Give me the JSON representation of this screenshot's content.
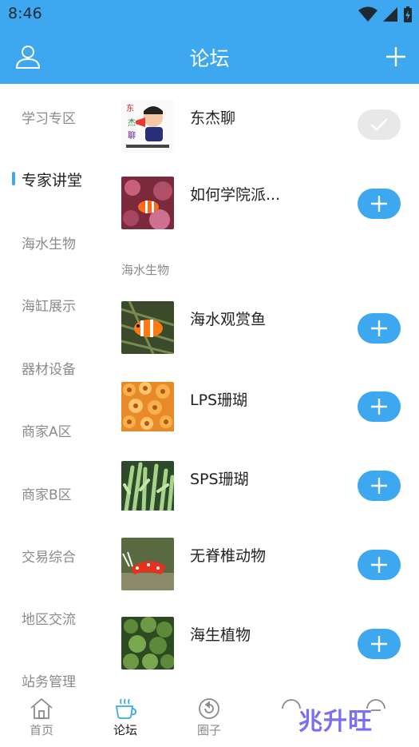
{
  "status": {
    "time": "8:46"
  },
  "header": {
    "title": "论坛"
  },
  "sidebar": {
    "items": [
      {
        "label": "学习专区"
      },
      {
        "label": "专家讲堂"
      },
      {
        "label": "海水生物"
      },
      {
        "label": "海缸展示"
      },
      {
        "label": "器材设备"
      },
      {
        "label": "商家A区"
      },
      {
        "label": "商家B区"
      },
      {
        "label": "交易综合"
      },
      {
        "label": "地区交流"
      },
      {
        "label": "站务管理"
      }
    ],
    "active_index": 1
  },
  "content": {
    "top_rows": [
      {
        "label": "东杰聊",
        "followed": true,
        "thumb": "avatar"
      },
      {
        "label": "如何学院派...",
        "followed": false,
        "thumb": "clownfish-anemone"
      }
    ],
    "section_title": "海水生物",
    "rows": [
      {
        "label": "海水观赏鱼",
        "followed": false,
        "thumb": "clownfish"
      },
      {
        "label": "LPS珊瑚",
        "followed": false,
        "thumb": "lps-coral"
      },
      {
        "label": "SPS珊瑚",
        "followed": false,
        "thumb": "sps-coral"
      },
      {
        "label": "无脊椎动物",
        "followed": false,
        "thumb": "shrimp"
      },
      {
        "label": "海生植物",
        "followed": false,
        "thumb": "algae"
      }
    ]
  },
  "tabbar": {
    "tabs": [
      {
        "label": "首页",
        "icon": "home-icon"
      },
      {
        "label": "论坛",
        "icon": "cup-icon"
      },
      {
        "label": "圈子",
        "icon": "circle-icon"
      }
    ]
  },
  "watermark": {
    "text": "兆升旺"
  },
  "colors": {
    "accent": "#3da7ef"
  }
}
